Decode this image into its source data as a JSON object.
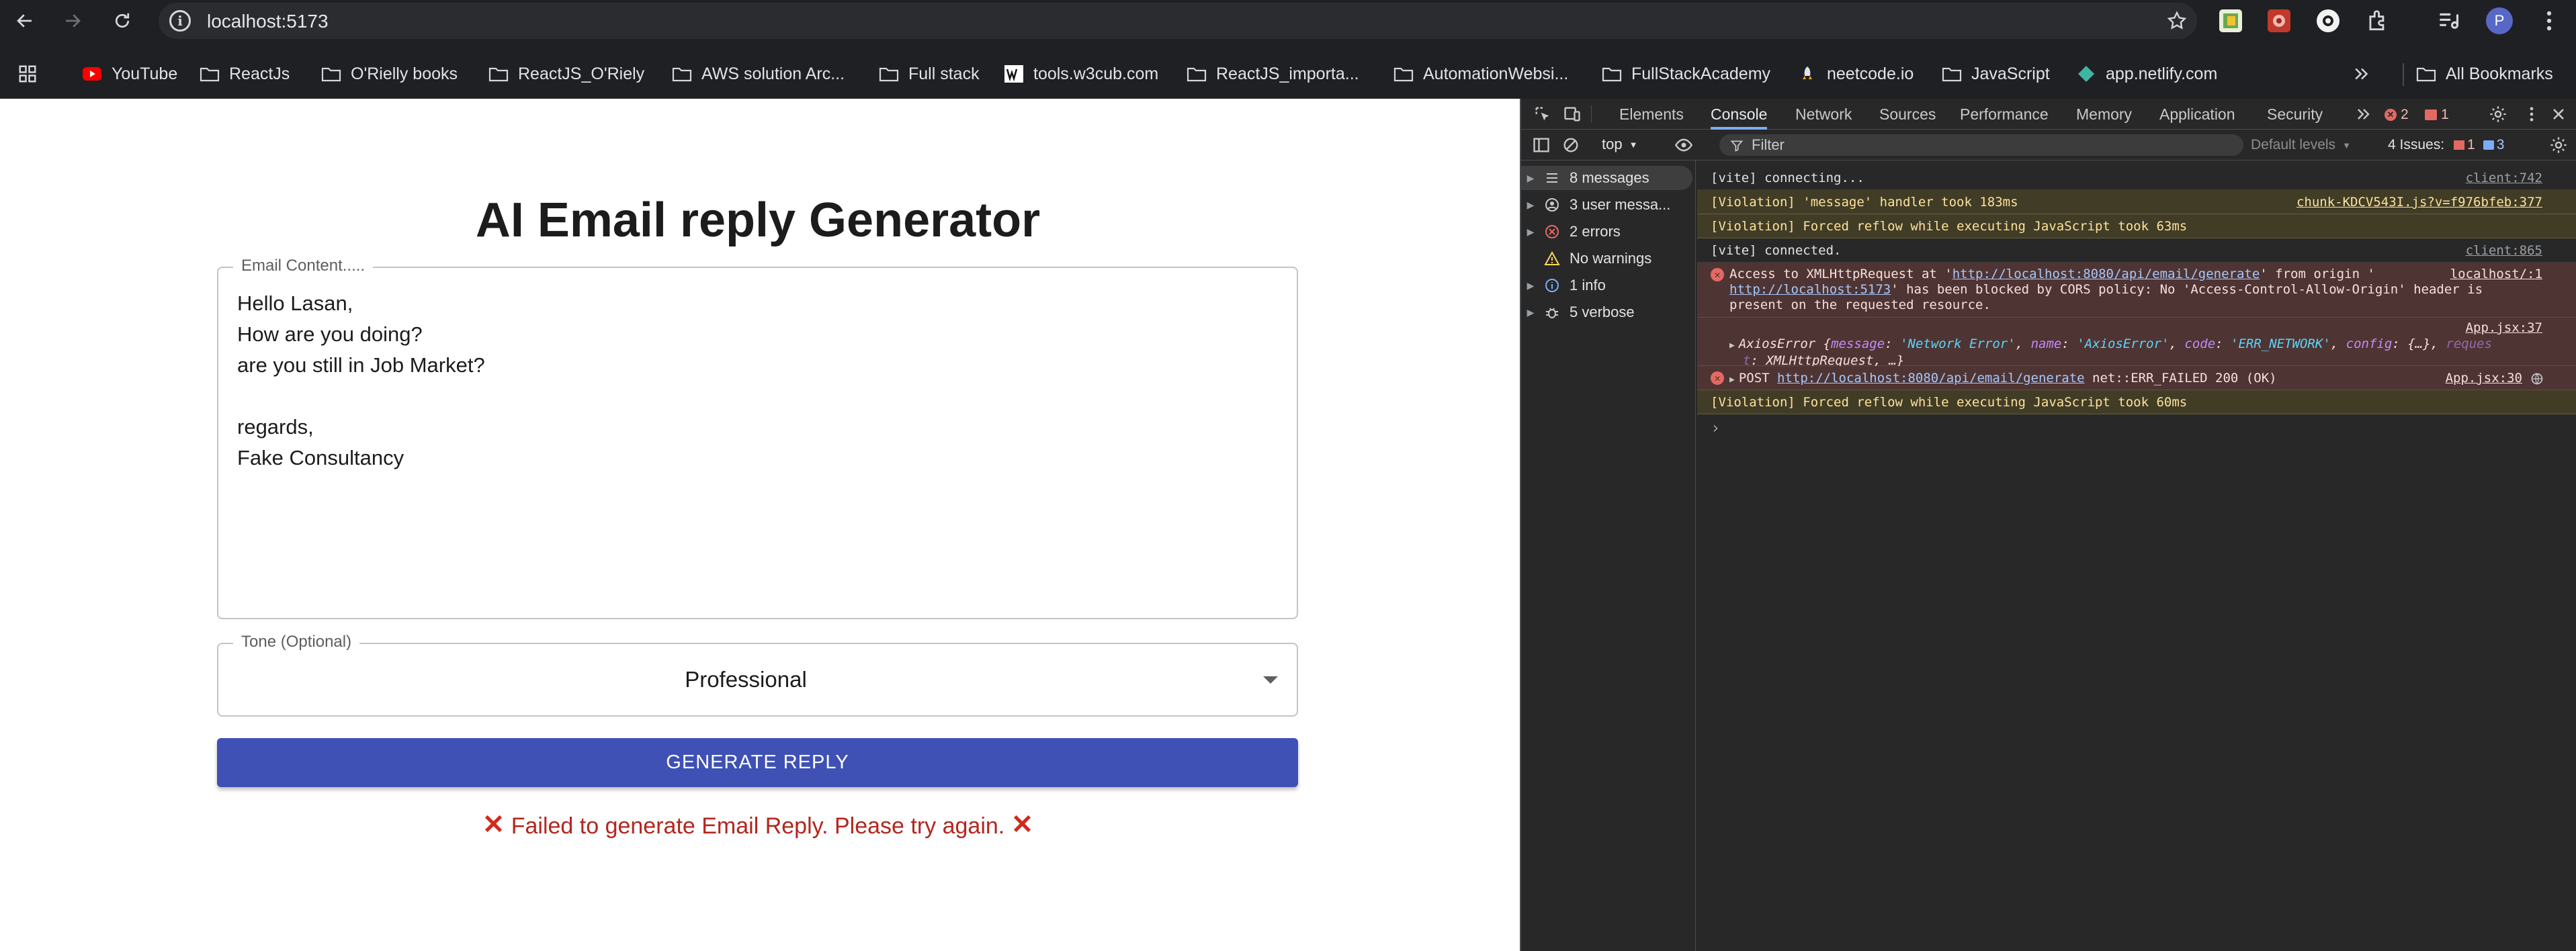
{
  "browser": {
    "url": "localhost:5173",
    "profile_initial": "P",
    "bookmarks": [
      "YouTube",
      "ReactJs",
      "O'Rielly books",
      "ReactJS_O'Riely",
      "AWS solution Arc...",
      "Full stack",
      "tools.w3cub.com",
      "ReactJS_importa...",
      "AutomationWebsi...",
      "FullStackAcademy",
      "neetcode.io",
      "JavaScript",
      "app.netlify.com"
    ],
    "all_bookmarks": "All Bookmarks"
  },
  "app": {
    "title": "AI Email reply Generator",
    "email_label": "Email Content.....",
    "email_value": "Hello Lasan,\nHow are you doing?\nare you still in Job Market?\n\nregards,\nFake Consultancy",
    "tone_label": "Tone (Optional)",
    "tone_value": "Professional",
    "generate_label": "GENERATE REPLY",
    "error_text": "Failed to generate Email Reply. Please try again.",
    "error_glyph": "✕"
  },
  "devtools": {
    "tabs": [
      "Elements",
      "Console",
      "Network",
      "Sources",
      "Performance",
      "Memory",
      "Application",
      "Security"
    ],
    "error_count": "2",
    "issue_badge": "1",
    "context": "top",
    "filter_placeholder": "Filter",
    "levels": "Default levels",
    "issues_label": "4 Issues:",
    "issues_err": "1",
    "issues_info": "3",
    "sidebar": [
      "8 messages",
      "3 user messa...",
      "2 errors",
      "No warnings",
      "1 info",
      "5 verbose"
    ],
    "console": {
      "r1_text": "[vite] connecting...",
      "r1_src": "client:742",
      "r2_text": "[Violation] 'message' handler took 183ms",
      "r2_src": "chunk-KDCV543I.js?v=f976bfeb:377",
      "r3_text": "[Violation] Forced reflow while executing JavaScript took 63ms",
      "r4_text": "[vite] connected.",
      "r4_src": "client:865",
      "r5_a": "Access to XMLHttpRequest at '",
      "r5_link1": "http://localhost:8080/api/email/generate",
      "r5_b": "' from origin '",
      "r5_link2": "http://localhost:5173",
      "r5_c": "' has been blocked by CORS policy: No 'Access-Control-Allow-Origin' header is",
      "r5_d": "present on the requested resource.",
      "r5_src": "localhost/:1",
      "r6_src": "App.jsx:37",
      "r6_a": "AxiosError {",
      "r6_k1": "message",
      "r6_v1": "'Network Error'",
      "r6_k2": "name",
      "r6_v2": "'AxiosError'",
      "r6_k3": "code",
      "r6_v3": "'ERR_NETWORK'",
      "r6_k4": "config",
      "r6_v4": "{…}",
      "r6_k5": "reques",
      "r6_k5b": "t",
      "r6_v5": "XMLHttpRequest, …}",
      "r7_a": "POST ",
      "r7_link": "http://localhost:8080/api/email/generate",
      "r7_b": " net::ERR_FAILED 200 (OK)",
      "r7_src": "App.jsx:30",
      "r8_text": "[Violation] Forced reflow while executing JavaScript took 60ms",
      "prompt": "›"
    }
  }
}
